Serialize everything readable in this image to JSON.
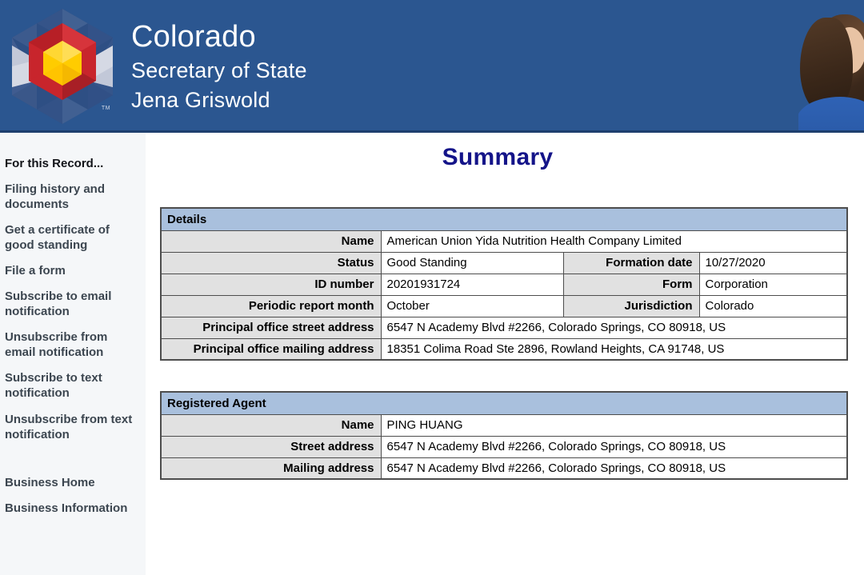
{
  "header": {
    "agency_line1": "Colorado",
    "agency_line2": "Secretary of State",
    "official_name": "Jena Griswold",
    "trademark": "TM",
    "banner_color": "#2b5690",
    "logo_colors": {
      "blue": "#2e4f84",
      "blue_light": "#7d8fb3",
      "pale": "#d5d9e4",
      "red": "#c8252c",
      "red_dark": "#a81f26",
      "yellow": "#ffcc00",
      "yellow_light": "#ffdd55"
    }
  },
  "sidebar": {
    "heading": "For this Record...",
    "items": [
      {
        "label": "Filing history and documents"
      },
      {
        "label": "Get a certificate of good standing"
      },
      {
        "label": "File a form"
      },
      {
        "label": "Subscribe to email notification"
      },
      {
        "label": "Unsubscribe from email notification"
      },
      {
        "label": "Subscribe to text notification"
      },
      {
        "label": "Unsubscribe from text notification"
      }
    ],
    "footer_items": [
      {
        "label": "Business Home"
      },
      {
        "label": "Business Information"
      }
    ]
  },
  "main": {
    "title": "Summary",
    "title_color": "#141489",
    "details": {
      "section_title": "Details",
      "rows": {
        "name_label": "Name",
        "name_value": "American Union Yida Nutrition Health Company Limited",
        "status_label": "Status",
        "status_value": "Good Standing",
        "formation_date_label": "Formation date",
        "formation_date_value": "10/27/2020",
        "id_number_label": "ID number",
        "id_number_value": "20201931724",
        "form_label": "Form",
        "form_value": "Corporation",
        "periodic_report_month_label": "Periodic report month",
        "periodic_report_month_value": "October",
        "jurisdiction_label": "Jurisdiction",
        "jurisdiction_value": "Colorado",
        "principal_street_label": "Principal office street address",
        "principal_street_value": "6547 N Academy Blvd #2266, Colorado Springs, CO 80918, US",
        "principal_mailing_label": "Principal office mailing address",
        "principal_mailing_value": "18351 Colima Road Ste 2896, Rowland Heights, CA 91748, US"
      }
    },
    "registered_agent": {
      "section_title": "Registered Agent",
      "rows": {
        "name_label": "Name",
        "name_value": "PING HUANG",
        "street_label": "Street address",
        "street_value": "6547 N Academy Blvd #2266, Colorado Springs, CO 80918, US",
        "mailing_label": "Mailing address",
        "mailing_value": "6547 N Academy Blvd #2266, Colorado Springs, CO 80918, US"
      }
    }
  }
}
